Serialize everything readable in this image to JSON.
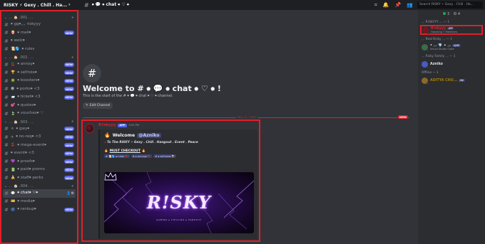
{
  "topbar": {
    "server_name": "RISKY ⚡ Gexy . Chill . Ha...",
    "channel_name": "⦁ 💬 ⦁ chat ⦁ ♡ ⦁",
    "search_placeholder": "Search RISKY ⚡ Gexy . Chill . Ha..."
  },
  "sidebar": {
    "categories": [
      {
        "label": "⸝⸝ 🏠 .001. ⸝⸝",
        "channels": [
          {
            "name": "⦁ gg⦁⸝⸝ riskyyy",
            "emoji": "",
            "badge": ""
          },
          {
            "name": "⦁ mail⦁",
            "emoji": "🍿",
            "badge": "NEW"
          },
          {
            "name": "⦁ welc⦁",
            "emoji": "",
            "badge": ""
          },
          {
            "name": "⦁ rules",
            "emoji": "📜🌎",
            "badge": ""
          }
        ]
      },
      {
        "label": "⸝⸝ 🏠 .002. ⸝⸝",
        "channels": [
          {
            "name": "⦁ annoy⦁",
            "emoji": "🍒",
            "badge": "NEW"
          },
          {
            "name": "⦁ selfrole⦁",
            "emoji": "🏆",
            "badge": "NEW"
          },
          {
            "name": "⦁ boosters⦁",
            "emoji": "🍀",
            "badge": "NEW"
          },
          {
            "name": "⦁ porks⦁ <3",
            "emoji": "🌑",
            "badge": "NEW"
          },
          {
            "name": "⦁ ticket⦁ <3",
            "emoji": "📨",
            "badge": "NEW"
          },
          {
            "name": "⦁ quotes⦁",
            "emoji": "💕",
            "badge": ""
          },
          {
            "name": "⦁ vouches⦁ ♡",
            "emoji": "🍃",
            "badge": ""
          }
        ]
      },
      {
        "label": "⸝⸝ 🏠 .003. ⸝⸝",
        "channels": [
          {
            "name": "⦁ gwy⦁",
            "emoji": "☀",
            "badge": "NEW"
          },
          {
            "name": "⦁ no-req⦁ <3",
            "emoji": "✈",
            "badge": "NEW"
          },
          {
            "name": "⦁ mega-event⦁",
            "emoji": "🍒",
            "badge": "NEW"
          },
          {
            "name": "⦁ event⦁ <3",
            "emoji": "",
            "badge": "NEW"
          },
          {
            "name": "⦁ proofs⦁",
            "emoji": "💜",
            "badge": "NEW"
          },
          {
            "name": "⦁ paid⦁ promo",
            "emoji": "📗",
            "badge": "NEW"
          },
          {
            "name": "⦁ staff⦁ perks",
            "emoji": "🍌",
            "badge": "NEW"
          }
        ]
      },
      {
        "label": "⸝⸝ 🏠 .004. ⸝⸝",
        "channels": [
          {
            "name": "⦁ chat⦁ ♡⦁",
            "emoji": "💬",
            "badge": "",
            "active": true
          },
          {
            "name": "⦁ media⦁",
            "emoji": "🎫",
            "badge": ""
          },
          {
            "name": "⦁ rankup⦁",
            "emoji": "🎆",
            "badge": "NEW"
          }
        ]
      }
    ]
  },
  "main": {
    "welcome_title": "Welcome to # ⦁ 💬 ⦁ chat ⦁ ♡ ⦁ !",
    "welcome_sub": "This is the start of the # ⦁ 💬 ⦁ chat ⦁ ♡ ⦁ channel.",
    "edit_label": "Edit Channel",
    "divider_date": "May 11, 2025",
    "divider_new": "NEW",
    "message": {
      "author": "R!skyyy",
      "badge": "APP",
      "time": "9:03 PM",
      "embed_title": "Welcome",
      "embed_mention": "@Azniko",
      "embed_tagline": "To The RISKY ⚡ Gexy . Chill . Hangout . Event . Peace",
      "must_checkout": "MUST CHECKOUT",
      "links": [
        "# 📜🌎 ⦁ rules 🍒",
        "# ⦁ annoy⦁ 🍒",
        "# ⦁ selfrole⦁ 🏆"
      ],
      "banner_text": "R!SKY",
      "banner_sub": "GAMING ⦁ CHILLING ⦁ HANGOUT"
    }
  },
  "members": {
    "online_count": "3",
    "offline_count": "4",
    "groups": [
      {
        "label": "⸝⸝ R!SKYYY ⸝⸝ — 1",
        "members": [
          {
            "name": "R!skyyy",
            "badge": "APP",
            "sub": "Handling 7 Members",
            "color": "#e0202a",
            "highlight": true
          }
        ]
      },
      {
        "label": "⸝⸝ Real Risky ⸝⸝ — 1",
        "members": [
          {
            "name": "• ⸝⸝ 💎 ✦ ⸝⸝",
            "badge": "A|NIE",
            "sub": "Visual Studio Code",
            "color": "#dbdee1"
          }
        ]
      },
      {
        "label": "⸝⸝ Risky Family ⸝⸝ — 1",
        "members": [
          {
            "name": "Azniko",
            "badge": "",
            "sub": "",
            "color": "#dbdee1"
          }
        ]
      },
      {
        "label": "Offline — 1",
        "members": [
          {
            "name": "ADITYA CHO...",
            "badge": "ANI",
            "sub": "",
            "color": "#a67c00"
          }
        ]
      }
    ]
  },
  "colors": {
    "accent_red": "#e0202a",
    "blurple": "#5865f2",
    "online": "#23a55a"
  }
}
